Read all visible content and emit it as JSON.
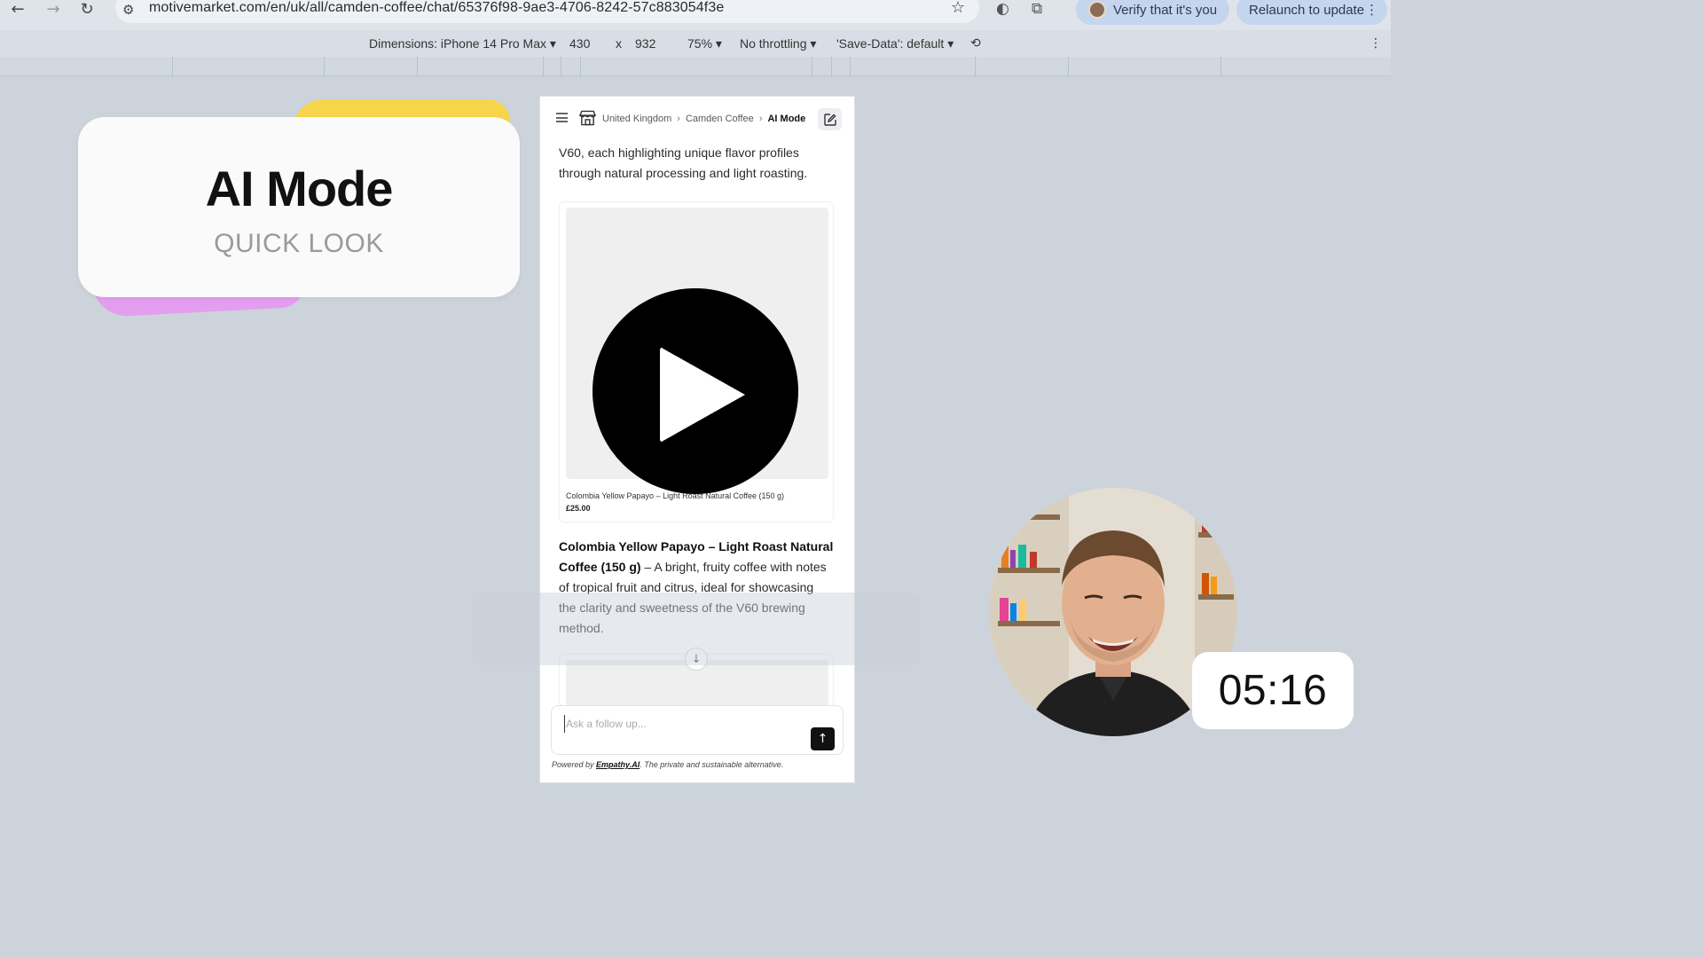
{
  "browser": {
    "url": "motivemarket.com/en/uk/all/camden-coffee/chat/65376f98-9ae3-4706-8242-57c883054f3e",
    "verify_label": "Verify that it's you",
    "relaunch_label": "Relaunch to update"
  },
  "devtools": {
    "dimensions_label": "Dimensions: iPhone 14 Pro Max",
    "width": "430",
    "times": "x",
    "height": "932",
    "zoom": "75%",
    "throttling": "No throttling",
    "save_data": "'Save-Data': default"
  },
  "title_card": {
    "title": "AI Mode",
    "subtitle": "QUICK LOOK"
  },
  "phone": {
    "breadcrumb": [
      "United Kingdom",
      "Camden Coffee",
      "AI Mode"
    ],
    "intro_text": "V60, each highlighting unique flavor profiles through natural processing and light roasting.",
    "product": {
      "name": "Colombia Yellow Papayo – Light Roast Natural Coffee (150 g)",
      "price": "£25.00"
    },
    "description_bold": "Colombia Yellow Papayo – Light Roast Natural Coffee (150 g)",
    "description_rest": " – A bright, fruity coffee with notes of tropical fruit and citrus, ideal for showcasing the clarity and sweetness of the V60 brewing method.",
    "input_placeholder": "Ask a follow up...",
    "powered_prefix": "Powered by ",
    "powered_link": "Empathy.AI",
    "powered_suffix": ". The private and sustainable alternative."
  },
  "video": {
    "timer": "05:16"
  },
  "icons": {
    "back": "back-arrow-icon",
    "forward": "forward-arrow-icon",
    "reload": "reload-icon",
    "star": "star-icon",
    "play": "play-icon",
    "send": "arrow-up-icon",
    "scroll": "arrow-down-icon"
  }
}
